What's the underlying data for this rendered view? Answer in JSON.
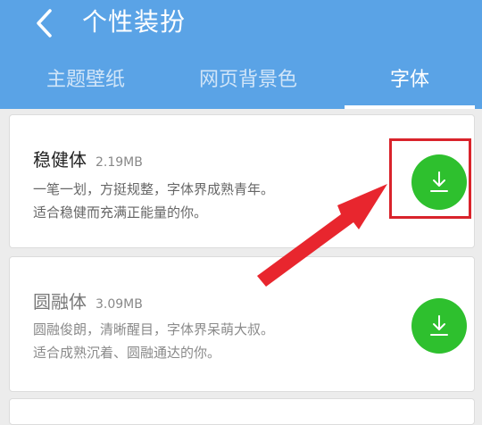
{
  "header": {
    "title": "个性装扮",
    "back_icon": "chevron-left-icon"
  },
  "tabs": [
    {
      "label": "主题壁纸",
      "active": false
    },
    {
      "label": "网页背景色",
      "active": false
    },
    {
      "label": "字体",
      "active": true
    }
  ],
  "fonts": [
    {
      "name": "稳健体",
      "size": "2.19MB",
      "desc_line1": "一笔一划，方挺规整，字体界成熟青年。",
      "desc_line2": "适合稳健而充满正能量的你。",
      "action_icon": "download-icon"
    },
    {
      "name": "圆融体",
      "size": "3.09MB",
      "desc_line1": "圆融俊朗，清晰醒目，字体界呆萌大叔。",
      "desc_line2": "适合成熟沉着、圆融通达的你。",
      "action_icon": "download-icon"
    }
  ],
  "colors": {
    "header_bg": "#5aa3e6",
    "download_green": "#2ec02e",
    "annotation_red": "#d9232b"
  }
}
